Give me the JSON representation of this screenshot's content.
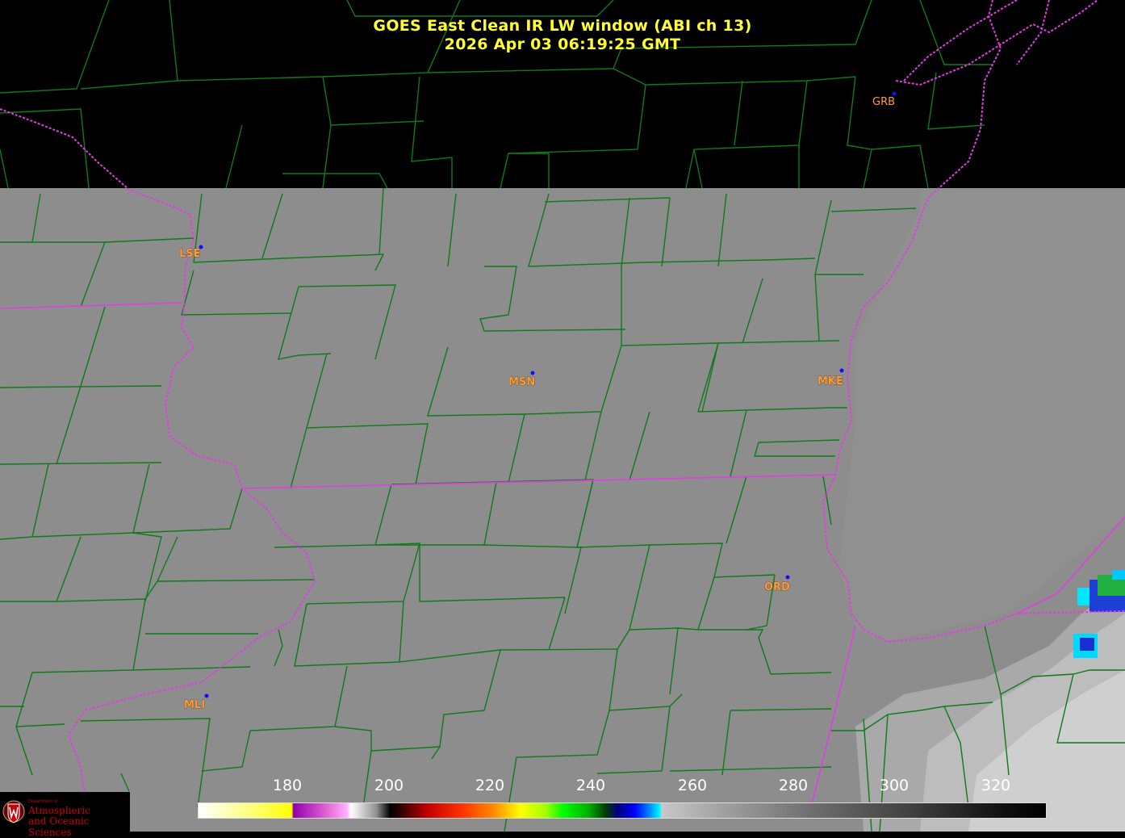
{
  "title": {
    "line1": "GOES East Clean IR LW window (ABI ch 13)",
    "line2": "2026 Apr 03  06:19:25 GMT"
  },
  "cities": [
    {
      "name": "GRB"
    },
    {
      "name": "LSE"
    },
    {
      "name": "MSN"
    },
    {
      "name": "MKE"
    },
    {
      "name": "ORD"
    },
    {
      "name": "MLI"
    }
  ],
  "colorbar": {
    "ticks": [
      "180",
      "200",
      "220",
      "240",
      "260",
      "280",
      "300",
      "320"
    ],
    "range": [
      164,
      332
    ],
    "colors": {
      "cloud_free_gray": "#8e8e8e",
      "county_lines": "#0f7a1a",
      "state_boundaries": "#e23ce6",
      "city_label": "#ff9c3c",
      "title": "#ffff33"
    }
  },
  "logo": {
    "small": "Department of",
    "line1": "Atmospheric",
    "line2": "and Oceanic Sciences",
    "icon": "uw-crest-icon"
  }
}
